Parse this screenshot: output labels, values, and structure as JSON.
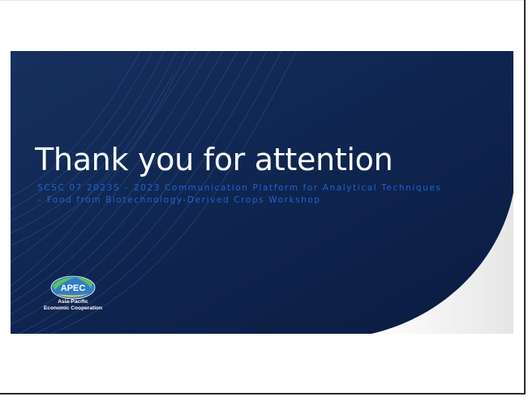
{
  "slide": {
    "title": "Thank you for attention",
    "subtitle_line1": "SCSC 07 2023S – 2023 Communication Platform for Analytical Techniques",
    "subtitle_line2": "– Food from Biotechnology-Derived Crops Workshop"
  },
  "logo": {
    "mark_text": "APEC",
    "line1": "Asia-Pacific",
    "line2": "Economic Cooperation"
  },
  "colors": {
    "slide_background": "#0c1f45",
    "slide_background_light": "#16305e",
    "subtitle": "#1e64d2",
    "curve_fill": "#f4f4f4"
  }
}
